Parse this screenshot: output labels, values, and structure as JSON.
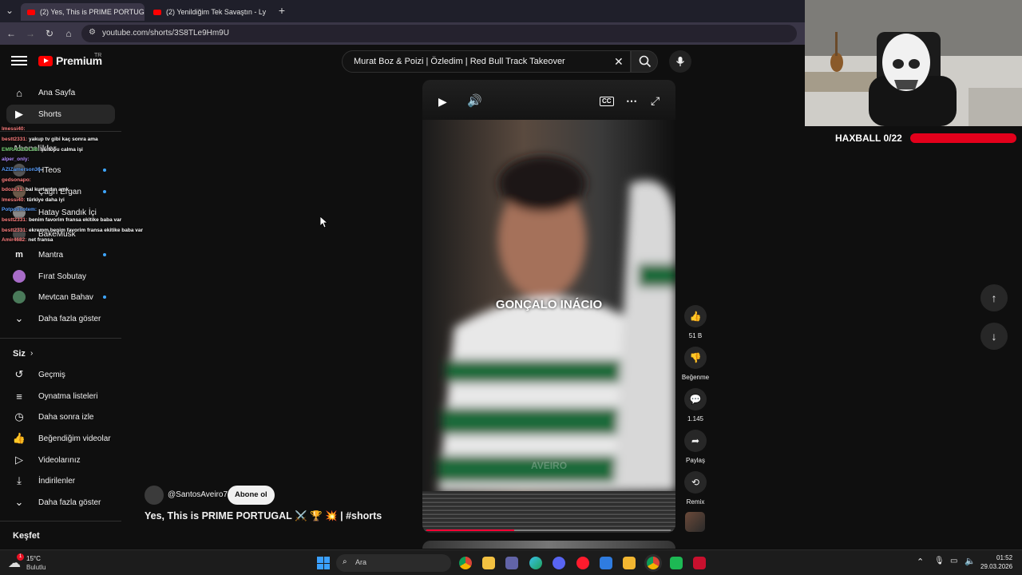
{
  "browser": {
    "tabs": [
      {
        "label": "(2) Yes, This is PRIME PORTUGAL",
        "active": true
      },
      {
        "label": "(2) Yenildiğim Tek Savaştın - Ly",
        "active": false
      }
    ],
    "url": "youtube.com/shorts/3S8TLe9Hm9U"
  },
  "header": {
    "logo_text": "Premium",
    "logo_region": "TR",
    "search_query": "Murat Boz & Poizi | Özledim | Red Bull Track Takeover"
  },
  "sidebar": {
    "main": [
      {
        "label": "Ana Sayfa",
        "icon": "home-icon"
      },
      {
        "label": "Shorts",
        "icon": "shorts-icon",
        "active": true
      }
    ],
    "subscriptions_header": "Abonelikler",
    "subscriptions": [
      {
        "label": "HTeos",
        "dot": true
      },
      {
        "label": "Çağrı Ergan",
        "dot": true
      },
      {
        "label": "Hatay Sandık İçi",
        "dot": false
      },
      {
        "label": "BakeMusk",
        "dot": false
      },
      {
        "label": "Mantra",
        "dot": true
      },
      {
        "label": "Fırat Sobutay",
        "dot": false
      },
      {
        "label": "Mevtcan Bahav",
        "dot": true
      }
    ],
    "show_more": "Daha fazla göster",
    "you_header": "Siz",
    "you_items": [
      {
        "label": "Geçmiş",
        "icon": "history-icon"
      },
      {
        "label": "Oynatma listeleri",
        "icon": "playlist-icon"
      },
      {
        "label": "Daha sonra izle",
        "icon": "clock-icon"
      },
      {
        "label": "Beğendiğim videolar",
        "icon": "thumbs-up-icon"
      },
      {
        "label": "Videolarınız",
        "icon": "video-icon"
      },
      {
        "label": "İndirilenler",
        "icon": "download-icon"
      }
    ],
    "show_more_2": "Daha fazla göster",
    "explore_header": "Keşfet"
  },
  "chat": [
    {
      "user": "lmessi40:",
      "msg": ""
    },
    {
      "user": "bestt2331:",
      "msg": "yakup tv gibi kaç sonra ama"
    },
    {
      "user": "EMRAOGUL98:",
      "msg": "şu topu calma işi"
    },
    {
      "user": "alper_only:",
      "msg": ""
    },
    {
      "user": "AZIZamerson36:",
      "msg": ""
    },
    {
      "user": "gedsonapo:",
      "msg": ""
    },
    {
      "user": "bdoze31:",
      "msg": "bal kurtardın amk"
    },
    {
      "user": "lmessi40:",
      "msg": "türkiye daha iyi"
    },
    {
      "user": "Potpotinotem:",
      "msg": ""
    },
    {
      "user": "bestt2331:",
      "msg": "benim favorim fransa ekitike baba var"
    },
    {
      "user": "bestt2331:",
      "msg": "ekremm benim favorim fransa ekitike baba var"
    },
    {
      "user": "Amir4682:",
      "msg": "net fransa"
    }
  ],
  "video": {
    "overlay_text": "GONÇALO INÁCIO",
    "watermark": "AVEIRO",
    "progress": 0.36,
    "channel": "@SantosAveiro7",
    "subscribe_label": "Abone ol",
    "title": "Yes, This is PRIME PORTUGAL ⚔️ 🏆 💥 | #shorts"
  },
  "actions": [
    {
      "icon": "thumbs-up-icon",
      "label": "51 B"
    },
    {
      "icon": "thumbs-down-icon",
      "label": "Beğenme"
    },
    {
      "icon": "comment-icon",
      "label": "1.145"
    },
    {
      "icon": "share-icon",
      "label": "Paylaş"
    },
    {
      "icon": "remix-icon",
      "label": "Remix"
    }
  ],
  "stream_overlay": {
    "haxball_label": "HAXBALL 0/22"
  },
  "taskbar": {
    "weather_temp": "15°C",
    "weather_desc": "Bulutlu",
    "weather_badge": "1",
    "search_placeholder": "Ara",
    "time": "01:52",
    "date": "29.03.2026"
  },
  "colors": {
    "accent_red": "#ff0000",
    "subscription_dot": "#3ea6ff",
    "haxball_bar": "#e3001b"
  }
}
